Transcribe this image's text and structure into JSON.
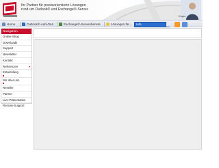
{
  "header": {
    "tagline_line1": "Ihr Partner für praxisorientierte Lösungen",
    "tagline_line2": "rund um Outlook® und Exchange®-Server",
    "expert_label": "Exper",
    "colors": {
      "brand_red": "#c8102e",
      "accent_blue": "#2c6fd1"
    }
  },
  "toolbar": {
    "items": [
      {
        "label": "Home",
        "icon": "home-icon"
      },
      {
        "label": "Outlook®-Add-Ons",
        "icon": "outlook-addon-icon"
      },
      {
        "label": "Exchange®-Serverdienste",
        "icon": "exchange-icon"
      },
      {
        "label": "Lösungen für...",
        "icon": "lightbulb-icon"
      }
    ],
    "search_value": "Info",
    "rss_icon": "rss-icon",
    "extra_icon": "link-icon"
  },
  "nav": {
    "heading": "Navigation",
    "items": [
      {
        "label": "Online-Shop",
        "arrow": false
      },
      {
        "label": "Downloads",
        "arrow": false
      },
      {
        "label": "Support",
        "arrow": false
      },
      {
        "label": "Newsletter",
        "arrow": false
      },
      {
        "label": "Kontakt",
        "arrow": false
      },
      {
        "label": "Referenzen",
        "arrow": true
      },
      {
        "label": "Entwicklung",
        "arrow": false,
        "sub": true
      },
      {
        "label": "Wir über uns",
        "arrow": false,
        "sub": true
      },
      {
        "label": "Reseller",
        "arrow": false
      },
      {
        "label": "Partner",
        "arrow": false
      },
      {
        "label": "Live-Präsentation",
        "arrow": false
      },
      {
        "label": "Remote-Support",
        "arrow": false
      }
    ]
  }
}
